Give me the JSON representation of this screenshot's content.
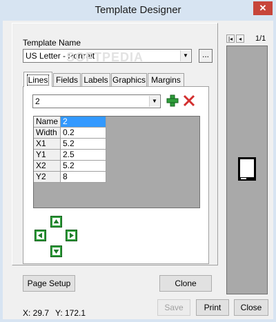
{
  "window": {
    "title": "Template Designer",
    "close_glyph": "✕"
  },
  "template": {
    "label": "Template Name",
    "value": "US Letter - Portrait",
    "more_label": "..."
  },
  "tabs": [
    {
      "label": "Lines",
      "active": true
    },
    {
      "label": "Fields",
      "active": false
    },
    {
      "label": "Labels",
      "active": false
    },
    {
      "label": "Graphics",
      "active": false
    },
    {
      "label": "Margins",
      "active": false
    }
  ],
  "line_selector": {
    "value": "2"
  },
  "icons": {
    "add": "plus-icon",
    "delete": "x-icon",
    "arrows": [
      "arrow-up-icon",
      "arrow-left-icon",
      "arrow-right-icon",
      "arrow-down-icon"
    ]
  },
  "colors": {
    "add": "#2e9d3a",
    "delete": "#d32f2f",
    "selection": "#3399ff",
    "grid_bg": "#a9a9a9"
  },
  "properties": [
    {
      "name": "Name",
      "value": "2"
    },
    {
      "name": "Width",
      "value": "0.2"
    },
    {
      "name": "X1",
      "value": "5.2"
    },
    {
      "name": "Y1",
      "value": "2.5"
    },
    {
      "name": "X2",
      "value": "5.2"
    },
    {
      "name": "Y2",
      "value": "8"
    }
  ],
  "buttons": {
    "page_setup": "Page Setup",
    "clone": "Clone",
    "save": "Save",
    "print": "Print",
    "close": "Close"
  },
  "status": {
    "x": "X: 29.7",
    "y": "Y: 172.1"
  },
  "preview": {
    "page_count": "1/1",
    "nav_first": "|◂",
    "nav_prev": "◂"
  },
  "watermark": "SOFTPEDIA"
}
